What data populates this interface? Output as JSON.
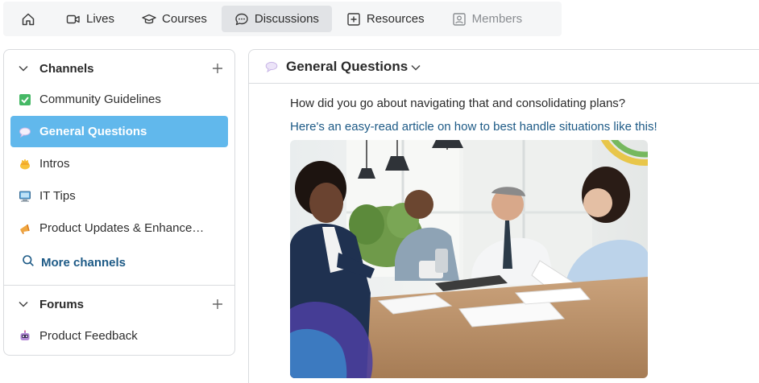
{
  "nav": {
    "home_icon": "home-icon",
    "items": [
      {
        "label": "Lives",
        "icon": "video-camera-icon"
      },
      {
        "label": "Courses",
        "icon": "graduation-cap-icon"
      },
      {
        "label": "Discussions",
        "icon": "chat-bubble-icon"
      },
      {
        "label": "Resources",
        "icon": "plus-square-icon"
      },
      {
        "label": "Members",
        "icon": "member-card-icon"
      }
    ],
    "active": "Discussions"
  },
  "sidebar": {
    "channels": {
      "title": "Channels",
      "items": [
        {
          "label": "Community Guidelines",
          "icon": "check-box-icon"
        },
        {
          "label": "General Questions",
          "icon": "speech-bubble-icon"
        },
        {
          "label": "Intros",
          "icon": "waving-hand-icon"
        },
        {
          "label": "IT Tips",
          "icon": "computer-icon"
        },
        {
          "label": "Product Updates & Enhancem…",
          "icon": "megaphone-icon"
        }
      ],
      "active": "General Questions",
      "more_label": "More channels"
    },
    "forums": {
      "title": "Forums",
      "items": [
        {
          "label": "Product Feedback",
          "icon": "robot-icon"
        }
      ]
    }
  },
  "main": {
    "channel_title": "General Questions",
    "message_text": "How did you go about navigating that and consolidating plans?",
    "link_text": "Here's an easy-read article on how to best handle situations like this!",
    "image_icon": "meeting-photo"
  },
  "colors": {
    "active_channel_bg": "#61b8ec",
    "link": "#1d5a86",
    "nav_active_bg": "#e1e3e6"
  }
}
